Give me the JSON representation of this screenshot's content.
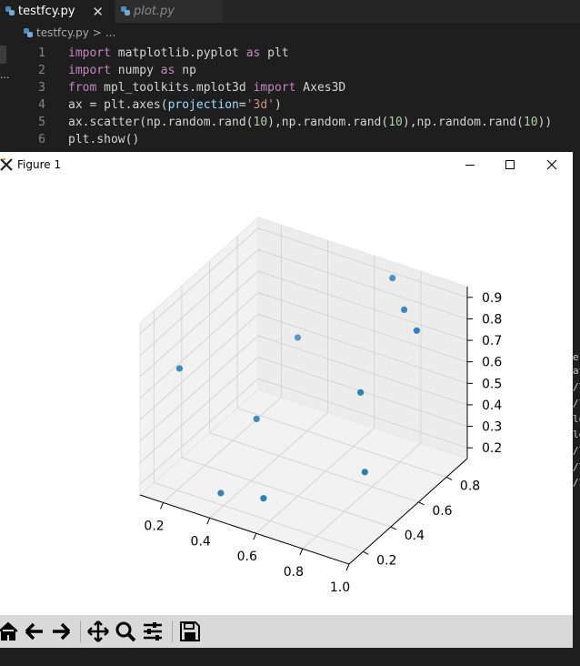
{
  "editor": {
    "tabs": [
      {
        "label": "testfcy.py",
        "close": "✕",
        "active": true
      },
      {
        "label": "plot.py",
        "active": false
      }
    ],
    "breadcrumb": {
      "file": "testfcy.py",
      "sep": ">",
      "rest": "..."
    },
    "activity_text": "...",
    "code_lines": [
      {
        "n": "1",
        "tokens": [
          [
            "k1",
            "import"
          ],
          [
            "t",
            " matplotlib.pyplot "
          ],
          [
            "k1",
            "as"
          ],
          [
            "t",
            " plt"
          ]
        ]
      },
      {
        "n": "2",
        "tokens": [
          [
            "k1",
            "import"
          ],
          [
            "t",
            " numpy "
          ],
          [
            "k1",
            "as"
          ],
          [
            "t",
            " np"
          ]
        ]
      },
      {
        "n": "3",
        "tokens": [
          [
            "k1",
            "from"
          ],
          [
            "t",
            " mpl_toolkits.mplot3d "
          ],
          [
            "k1",
            "import"
          ],
          [
            "t",
            " Axes3D"
          ]
        ]
      },
      {
        "n": "4",
        "tokens": [
          [
            "t",
            "ax = plt.axes("
          ],
          [
            "prm",
            "projection"
          ],
          [
            "t",
            "="
          ],
          [
            "str",
            "'3d'"
          ],
          [
            "t",
            ")"
          ]
        ]
      },
      {
        "n": "5",
        "tokens": [
          [
            "t",
            "ax.scatter(np.random.rand("
          ],
          [
            "num",
            "10"
          ],
          [
            "t",
            "),np.random.rand("
          ],
          [
            "num",
            "10"
          ],
          [
            "t",
            "),np.random.rand("
          ],
          [
            "num",
            "10"
          ],
          [
            "t",
            "))"
          ]
        ]
      },
      {
        "n": "6",
        "tokens": [
          [
            "t",
            "plt.show()"
          ]
        ]
      }
    ],
    "right_panel_fragments": [
      "e,",
      "at",
      "/l",
      "/l",
      "le",
      "le",
      "/l",
      "/l",
      "/l"
    ]
  },
  "figure_window": {
    "title": "Figure 1",
    "controls": [
      "minimize",
      "maximize",
      "close"
    ],
    "toolbar": [
      "home-icon",
      "back-icon",
      "forward-icon",
      "pan-icon",
      "zoom-icon",
      "configure-subplots-icon",
      "save-icon"
    ]
  },
  "chart_data": {
    "type": "scatter",
    "projection": "3d",
    "title": "",
    "xlabel": "",
    "ylabel": "",
    "zlabel": "",
    "x_ticks": [
      "0.2",
      "0.4",
      "0.6",
      "0.8",
      "1.0"
    ],
    "y_ticks": [
      "0.2",
      "0.4",
      "0.6",
      "0.8"
    ],
    "z_ticks": [
      "0.2",
      "0.3",
      "0.4",
      "0.5",
      "0.6",
      "0.7",
      "0.8",
      "0.9"
    ],
    "xlim": [
      0.1,
      1.0
    ],
    "ylim": [
      0.1,
      0.95
    ],
    "zlim": [
      0.15,
      0.95
    ],
    "grid": true,
    "marker_color": "#1f77b4",
    "x": [
      0.72,
      0.83,
      0.92,
      0.78,
      0.96,
      0.21,
      0.53,
      0.41,
      0.42,
      0.37
    ],
    "y": [
      0.88,
      0.78,
      0.72,
      0.55,
      0.28,
      0.2,
      0.27,
      0.42,
      0.7,
      0.23
    ],
    "z": [
      0.93,
      0.88,
      0.85,
      0.61,
      0.46,
      0.72,
      0.19,
      0.43,
      0.65,
      0.18
    ]
  }
}
